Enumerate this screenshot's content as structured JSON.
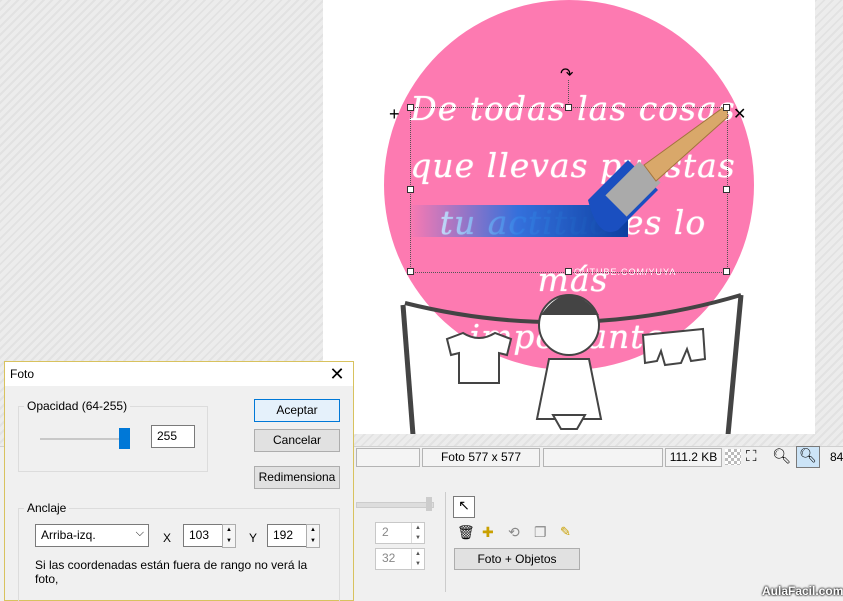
{
  "canvas": {
    "quote": "De todas las cosas\nque llevas puestas\ntu actitud es lo más\nimportante.",
    "credit": "YOUTUBE.COM/YUYA"
  },
  "statusbar": {
    "photo_size": "Foto 577 x 577",
    "file_size": "111.2 KB",
    "zoom_partial": "84"
  },
  "bottom_panel": {
    "spin1_value": "2",
    "spin2_value": "32",
    "mode_button": "Foto + Objetos"
  },
  "dialog": {
    "title": "Foto",
    "opacity_group": "Opacidad (64-255)",
    "opacity_value": "255",
    "opacity_level": 1.0,
    "accept": "Aceptar",
    "cancel": "Cancelar",
    "resize": "Redimensiona",
    "anchor_group": "Anclaje",
    "anchor_select": "Arriba-izq.",
    "x_label": "X",
    "x_value": "103",
    "y_label": "Y",
    "y_value": "192",
    "note": "Si las coordenadas están fuera de rango no verá la foto,"
  },
  "watermark": "AulaFacil.com",
  "colors": {
    "accent": "#0078d7",
    "circle": "#fd7ab1"
  }
}
